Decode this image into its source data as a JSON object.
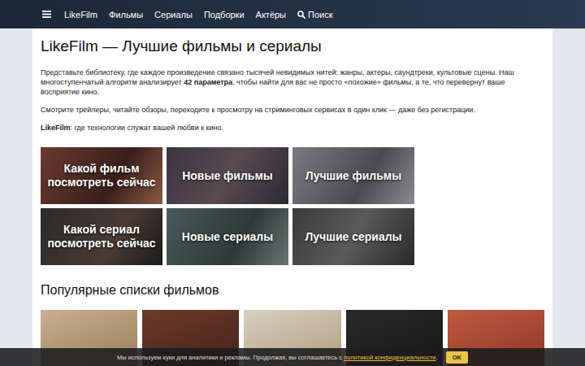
{
  "nav": {
    "brand": "LikeFilm",
    "items": [
      {
        "label": "Фильмы",
        "selected": false
      },
      {
        "label": "Сериалы",
        "selected": false
      },
      {
        "label": "Подборки",
        "selected": false
      },
      {
        "label": "Актёры",
        "selected": false
      }
    ],
    "search": {
      "label": "Поиск"
    }
  },
  "page": {
    "title": "LikeFilm — Лучшие фильмы и сериалы",
    "paragraphs": [
      {
        "segments": [
          {
            "text": "Представьте библиотеку, где каждое произведение связано тысячей невидимых нитей: жанры, актеры, саундтреки, культовые сцены. Наш многоступенчатый алгоритм анализирует ",
            "bold": false
          },
          {
            "text": "42 параметра",
            "bold": true
          },
          {
            "text": ", чтобы найти для вас не просто «похожие» фильмы, а те, что перевернут ваше восприятие кино.",
            "bold": false
          }
        ]
      },
      {
        "segments": [
          {
            "text": "Смотрите трейлеры, читайте обзоры, переходите к просмотру на стриминговых сервисах в один клик — даже без регистрации.",
            "bold": false
          }
        ]
      },
      {
        "segments": [
          {
            "text": "LikeFilm",
            "bold": true
          },
          {
            "text": ": где технологии служат вашей любви к кино.",
            "bold": false
          }
        ]
      }
    ]
  },
  "tiles": [
    {
      "label": "Какой фильм посмотреть сейчас"
    },
    {
      "label": "Новые фильмы"
    },
    {
      "label": "Лучшие фильмы"
    },
    {
      "label": "Какой сериал посмотреть сейчас"
    },
    {
      "label": "Новые сериалы"
    },
    {
      "label": "Лучшие сериалы"
    }
  ],
  "popular": {
    "title": "Популярные списки фильмов",
    "cards": [
      {},
      {},
      {},
      {},
      {}
    ]
  },
  "cookie": {
    "text": "Мы используем куки для аналитики и рекламы. Продолжая, вы соглашаетесь с ",
    "link": "политикой конфиденциальности",
    "end": ".",
    "button": "OK"
  }
}
